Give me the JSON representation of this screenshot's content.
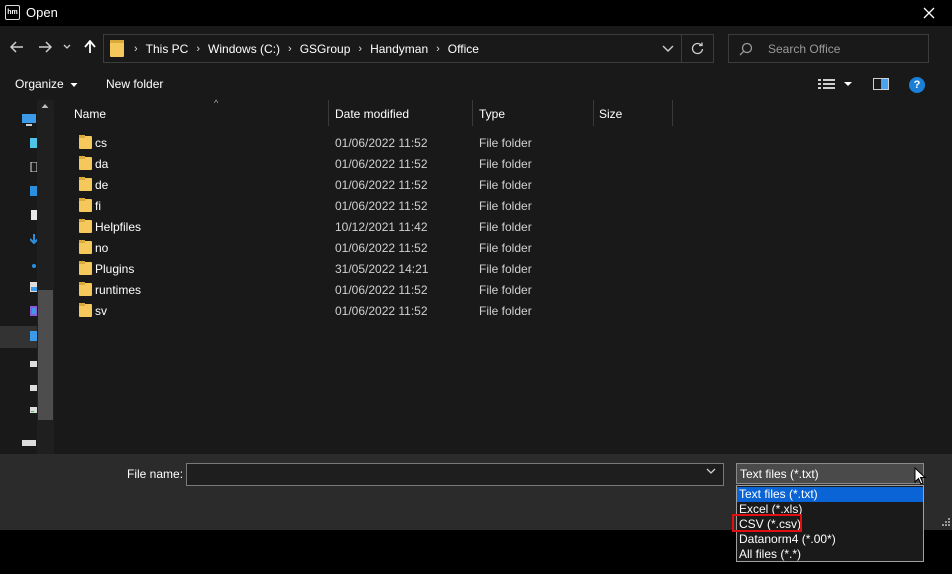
{
  "titlebar": {
    "app_icon": "hm",
    "title": "Open",
    "close_icon": "close-icon"
  },
  "nav": {
    "back_icon": "arrow-left-icon",
    "forward_icon": "arrow-right-icon",
    "recent_icon": "chevron-down-icon",
    "up_icon": "arrow-up-icon"
  },
  "address": {
    "crumbs": [
      "This PC",
      "Windows (C:)",
      "GSGroup",
      "Handyman",
      "Office"
    ],
    "refresh_icon": "refresh-icon"
  },
  "search": {
    "placeholder": "Search Office",
    "icon": "search-icon"
  },
  "toolbar": {
    "organize_label": "Organize",
    "new_folder_label": "New folder",
    "views_icon": "view-list-icon",
    "preview_icon": "preview-pane-icon",
    "help_label": "?"
  },
  "columns": {
    "name": "Name",
    "date": "Date modified",
    "type": "Type",
    "size": "Size"
  },
  "files": [
    {
      "name": "cs",
      "date": "01/06/2022 11:52",
      "type": "File folder"
    },
    {
      "name": "da",
      "date": "01/06/2022 11:52",
      "type": "File folder"
    },
    {
      "name": "de",
      "date": "01/06/2022 11:52",
      "type": "File folder"
    },
    {
      "name": "fi",
      "date": "01/06/2022 11:52",
      "type": "File folder"
    },
    {
      "name": "Helpfiles",
      "date": "10/12/2021 11:42",
      "type": "File folder"
    },
    {
      "name": "no",
      "date": "01/06/2022 11:52",
      "type": "File folder"
    },
    {
      "name": "Plugins",
      "date": "31/05/2022 14:21",
      "type": "File folder"
    },
    {
      "name": "runtimes",
      "date": "01/06/2022 11:52",
      "type": "File folder"
    },
    {
      "name": "sv",
      "date": "01/06/2022 11:52",
      "type": "File folder"
    }
  ],
  "bottom": {
    "file_name_label": "File name:",
    "file_name_value": "",
    "file_type_selected": "Text files (*.txt)"
  },
  "filetype_options": [
    "Text files (*.txt)",
    "Excel (*.xls)",
    "CSV (*.csv)",
    "Datanorm4 (*.00*)",
    "All files (*.*)"
  ],
  "colors": {
    "background": "#191919",
    "bottom_pane": "#2b2b2b",
    "folder": "#f4c85a",
    "selection": "#0a64d6",
    "highlight_box": "#e01010",
    "help_icon": "#1a7fd6"
  }
}
